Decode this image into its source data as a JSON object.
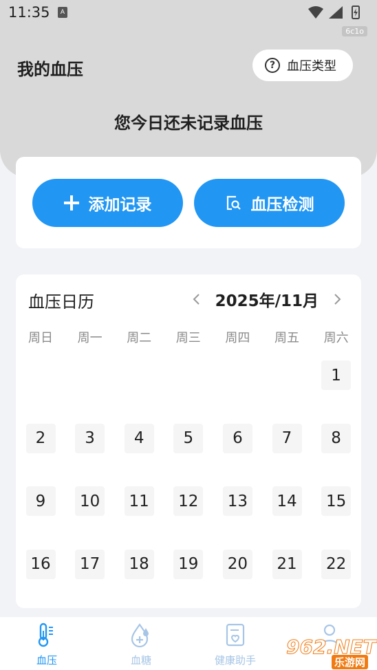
{
  "status_bar": {
    "time": "11:35",
    "app_badge": "A",
    "build_tag": "6c1o"
  },
  "header": {
    "title": "我的血压",
    "type_button_label": "血压类型",
    "no_record_text": "您今日还未记录血压"
  },
  "actions": {
    "add_label": "添加记录",
    "detect_label": "血压检测"
  },
  "calendar": {
    "title": "血压日历",
    "month_label": "2025年/11月",
    "weekdays": [
      "周日",
      "周一",
      "周二",
      "周三",
      "周四",
      "周五",
      "周六"
    ],
    "first_weekday_index": 6,
    "days": [
      1,
      2,
      3,
      4,
      5,
      6,
      7,
      8,
      9,
      10,
      11,
      12,
      13,
      14,
      15,
      16,
      17,
      18,
      19,
      20,
      21,
      22
    ]
  },
  "tab_bar": {
    "tabs": [
      {
        "label": "血压",
        "icon": "thermometer-icon",
        "active": true
      },
      {
        "label": "血糖",
        "icon": "blood-drop-icon",
        "active": false
      },
      {
        "label": "健康助手",
        "icon": "health-report-icon",
        "active": false
      },
      {
        "label": "",
        "icon": "profile-icon",
        "active": false
      }
    ]
  },
  "watermark": {
    "main": "962.NET",
    "sub": "乐游网"
  },
  "colors": {
    "accent": "#2196f3",
    "header_bg": "#d9d9d9",
    "page_bg": "#f2f3f7",
    "tab_inactive": "#a7c5e6"
  }
}
